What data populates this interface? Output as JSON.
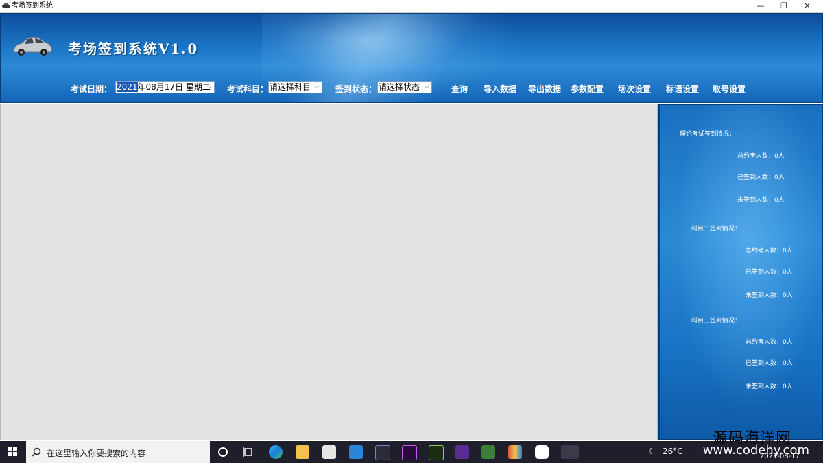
{
  "window": {
    "title": "考场签到系统",
    "minimize": "—",
    "maximize": "❐",
    "close": "✕"
  },
  "header": {
    "app_title": "考场签到系统V1.0",
    "filters": {
      "date_label": "考试日期：",
      "date_year": "2021",
      "date_rest": "年08月17日  星期二",
      "subject_label": "考试科目：",
      "subject_value": "请选择科目",
      "status_label": "签到状态：",
      "status_value": "请选择状态"
    },
    "toolbar": [
      "查询",
      "导入数据",
      "导出数据",
      "参数配置",
      "场次设置",
      "标语设置",
      "取号设置"
    ]
  },
  "stats": {
    "theory_title": "理论考试签到情况：",
    "theory_total": "总约考人数：0人",
    "theory_signed": "已签到人数：0人",
    "theory_unsigned": "未签到人数：0人",
    "subject2_title": "科目二签到情况：",
    "subject2_total": "总约考人数：0人",
    "subject2_signed": "已签到人数：0人",
    "subject2_unsigned": "未签到人数：0人",
    "subject3_title": "科目三签到情况：",
    "subject3_total": "总约考人数：0人",
    "subject3_signed": "已签到人数：0人",
    "subject3_unsigned": "未签到人数：0人"
  },
  "taskbar": {
    "search_placeholder": "在这里输入你要搜索的内容",
    "weather": "26°C",
    "date": "2021-08-17",
    "watermark": "源码海洋网",
    "watermark_url": "www.codehy.com"
  },
  "colors": {
    "header_blue": "#1a73c4",
    "panel_gray": "#e3e3e3",
    "taskbar": "#1f1f2b"
  }
}
